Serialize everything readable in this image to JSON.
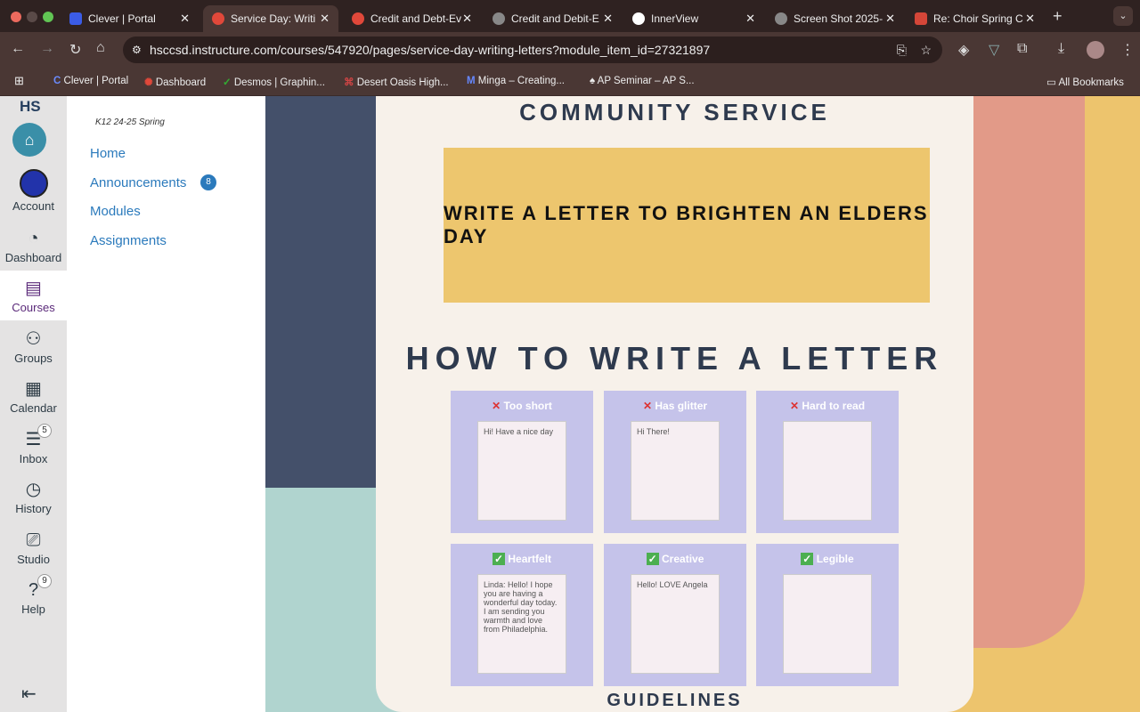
{
  "browser": {
    "tabs": [
      {
        "title": "Clever | Portal",
        "color": "#3b5ce6"
      },
      {
        "title": "Service Day: Writing",
        "color": "#e0483a"
      },
      {
        "title": "Credit and Debt-Ev",
        "color": "#e0483a"
      },
      {
        "title": "Credit and Debit-E",
        "color": "#888888"
      },
      {
        "title": "InnerView",
        "color": "#7a4bd0"
      },
      {
        "title": "Screen Shot 2025-",
        "color": "#888888"
      },
      {
        "title": "Re: Choir Spring C",
        "color": "#d44638"
      }
    ],
    "url": "hsccsd.instructure.com/courses/547920/pages/service-day-writing-letters?module_item_id=27321897",
    "bookmarks": [
      "Clever | Portal",
      "Dashboard",
      "Desmos | Graphin...",
      "Desert Oasis High...",
      "Minga – Creating...",
      "AP Seminar – AP S..."
    ],
    "all_bookmarks": "All Bookmarks"
  },
  "global_nav": {
    "logo": "HS",
    "items": [
      {
        "label": "Account"
      },
      {
        "label": "Dashboard",
        "icon": "dashboard-icon"
      },
      {
        "label": "Courses",
        "icon": "courses-icon"
      },
      {
        "label": "Groups",
        "icon": "groups-icon"
      },
      {
        "label": "Calendar",
        "icon": "calendar-icon"
      },
      {
        "label": "Inbox",
        "icon": "inbox-icon",
        "badge": "5"
      },
      {
        "label": "History",
        "icon": "history-icon"
      },
      {
        "label": "Studio",
        "icon": "studio-icon"
      },
      {
        "label": "Help",
        "icon": "help-icon",
        "badge": "9"
      }
    ]
  },
  "course_nav": {
    "term": "K12 24-25 Spring",
    "items": [
      {
        "label": "Home"
      },
      {
        "label": "Announcements",
        "badge": "8"
      },
      {
        "label": "Modules"
      },
      {
        "label": "Assignments"
      }
    ]
  },
  "page": {
    "heading": "COMMUNITY SERVICE",
    "banner": "WRITE A LETTER TO BRIGHTEN AN ELDERS DAY",
    "subheading": "HOW TO WRITE A LETTER",
    "examples": [
      {
        "label": "Too short",
        "mark": "✕",
        "sample": "Hi! Have a nice day"
      },
      {
        "label": "Has glitter",
        "mark": "✕",
        "sample": "Hi There!"
      },
      {
        "label": "Hard to read",
        "mark": "✕",
        "sample": ""
      },
      {
        "label": "Heartfelt",
        "mark": "✓",
        "sample": "Linda: Hello! I hope you are having a wonderful day today. I am sending you warmth and love from Philadelphia."
      },
      {
        "label": "Creative",
        "mark": "✓",
        "sample": "Hello! LOVE Angela"
      },
      {
        "label": "Legible",
        "mark": "✓",
        "sample": ""
      }
    ],
    "footer_heading": "GUIDELINES"
  }
}
